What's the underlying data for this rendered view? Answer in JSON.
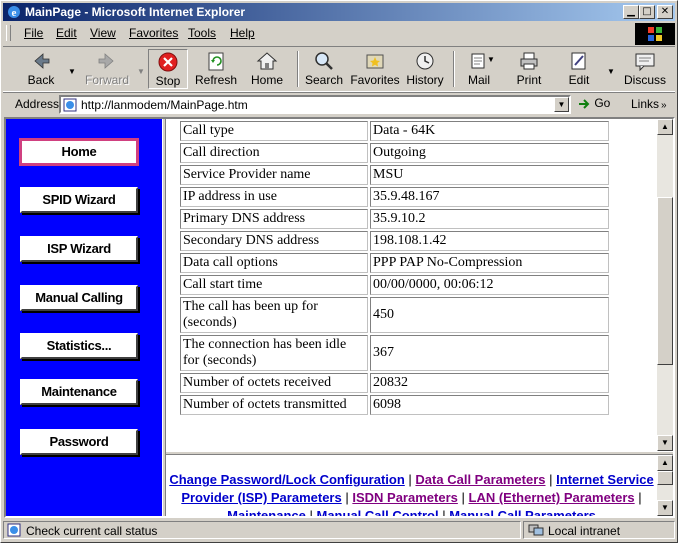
{
  "window": {
    "title": "MainPage - Microsoft Internet Explorer"
  },
  "menu": [
    "File",
    "Edit",
    "View",
    "Favorites",
    "Tools",
    "Help"
  ],
  "toolbar": {
    "back": "Back",
    "forward": "Forward",
    "stop": "Stop",
    "refresh": "Refresh",
    "home": "Home",
    "search": "Search",
    "favorites": "Favorites",
    "history": "History",
    "mail": "Mail",
    "print": "Print",
    "edit": "Edit",
    "discuss": "Discuss"
  },
  "address": {
    "label": "Address",
    "url": "http://lanmodem/MainPage.htm",
    "go": "Go",
    "links": "Links"
  },
  "nav": [
    "Home",
    "SPID Wizard",
    "ISP Wizard",
    "Manual Calling",
    "Statistics...",
    "Maintenance",
    "Password"
  ],
  "status_table": [
    {
      "key": "Call type",
      "value": "Data - 64K"
    },
    {
      "key": "Call direction",
      "value": "Outgoing"
    },
    {
      "key": "Service Provider name",
      "value": "MSU"
    },
    {
      "key": "IP address in use",
      "value": "35.9.48.167"
    },
    {
      "key": "Primary DNS address",
      "value": "35.9.10.2"
    },
    {
      "key": "Secondary DNS address",
      "value": "198.108.1.42"
    },
    {
      "key": "Data call options",
      "value": "PPP PAP No-Compression"
    },
    {
      "key": "Call start time",
      "value": "00/00/0000, 00:06:12"
    },
    {
      "key": "The call has been up for (seconds)",
      "value": "450"
    },
    {
      "key": "The connection has been idle for (seconds)",
      "value": "367"
    },
    {
      "key": "Number of octets received",
      "value": "20832"
    },
    {
      "key": "Number of octets transmitted",
      "value": "6098"
    }
  ],
  "links": {
    "change_password": "Change Password/Lock Configuration",
    "data_call": "Data Call Parameters",
    "isp": "Internet Service Provider (ISP) Parameters",
    "isdn": "ISDN Parameters",
    "lan": "LAN (Ethernet) Parameters",
    "maintenance": "Maintenance",
    "manual_call": "Manual Call Control",
    "manual_call_params": "Manual Call Parameters",
    "separator": "|"
  },
  "statusbar": {
    "text": "Check current call status",
    "zone": "Local intranet"
  },
  "colors": {
    "nav_bg": "#0000ff",
    "link": "#0000cc",
    "visited": "#800080",
    "title_start": "#0a246a",
    "title_end": "#a6caf0"
  }
}
